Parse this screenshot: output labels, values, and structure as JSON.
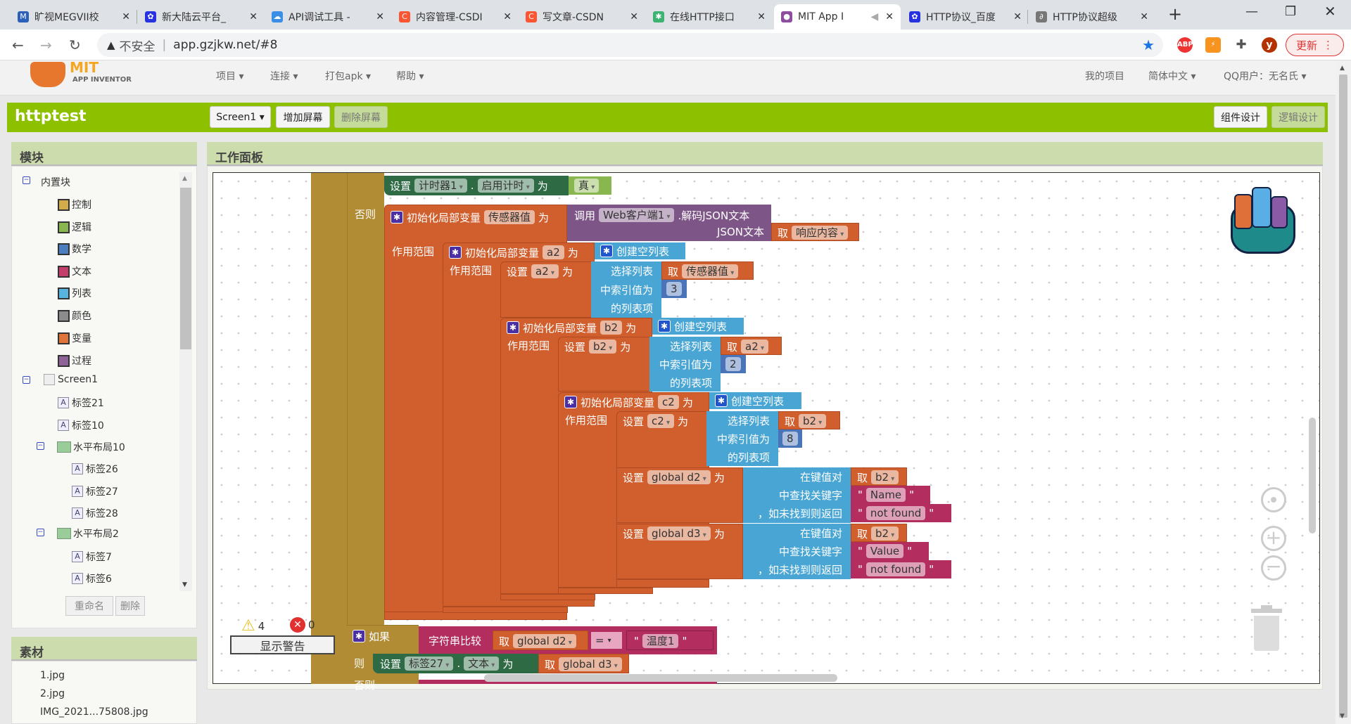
{
  "browser": {
    "tabs": [
      {
        "title": "旷视MEGVII校",
        "icon": "M",
        "color": "#2b5fb8"
      },
      {
        "title": "新大陆云平台_",
        "icon": "paw",
        "color": "#2932e1"
      },
      {
        "title": "API调试工具 -",
        "icon": "cloud",
        "color": "#3a8ee6"
      },
      {
        "title": "内容管理-CSDI",
        "icon": "C",
        "color": "#fc5531"
      },
      {
        "title": "写文章-CSDN",
        "icon": "C",
        "color": "#fc5531"
      },
      {
        "title": "在线HTTP接口",
        "icon": "gear",
        "color": "#3cb371"
      },
      {
        "title": "MIT App I",
        "icon": "mit",
        "color": "#8b4f9e",
        "active": true
      },
      {
        "title": "HTTP协议_百度",
        "icon": "paw",
        "color": "#2932e1"
      },
      {
        "title": "HTTP协议超级",
        "icon": "link",
        "color": "#555"
      }
    ],
    "new_tab": "+",
    "close": "✕",
    "not_secure": "不安全",
    "url": "app.gzjkw.net/#8",
    "update_label": "更新",
    "avatar_letter": "y",
    "abp": "ABP"
  },
  "app": {
    "logo_text": "MIT APP INVENTOR",
    "menu": [
      "项目",
      "连接",
      "打包apk",
      "帮助"
    ],
    "right_menu": [
      "我的项目",
      "简体中文",
      "QQ用户：无名氏"
    ],
    "project": "httptest",
    "screen_select": "Screen1",
    "add_screen": "增加屏幕",
    "remove_screen": "删除屏幕",
    "designer": "组件设计",
    "blocks_editor": "逻辑设计"
  },
  "blocks_panel": {
    "title": "模块",
    "builtin": "内置块",
    "categories": [
      {
        "label": "控制",
        "color": "#d2ab4b"
      },
      {
        "label": "逻辑",
        "color": "#8ab650"
      },
      {
        "label": "数学",
        "color": "#4a7ebf"
      },
      {
        "label": "文本",
        "color": "#c43d6b"
      },
      {
        "label": "列表",
        "color": "#57b4df"
      },
      {
        "label": "颜色",
        "color": "#8c8c8c"
      },
      {
        "label": "变量",
        "color": "#e07438"
      },
      {
        "label": "过程",
        "color": "#8e6397"
      }
    ],
    "screen": "Screen1",
    "components": [
      {
        "label": "标签21",
        "type": "label",
        "level": 1
      },
      {
        "label": "标签10",
        "type": "label",
        "level": 1
      },
      {
        "label": "水平布局10",
        "type": "layout",
        "level": 1
      },
      {
        "label": "标签26",
        "type": "label",
        "level": 2
      },
      {
        "label": "标签27",
        "type": "label",
        "level": 2
      },
      {
        "label": "标签28",
        "type": "label",
        "level": 2
      },
      {
        "label": "水平布局2",
        "type": "layout",
        "level": 1
      },
      {
        "label": "标签7",
        "type": "label",
        "level": 2
      },
      {
        "label": "标签6",
        "type": "label",
        "level": 2
      }
    ],
    "rename": "重命名",
    "delete": "删除"
  },
  "media": {
    "title": "素材",
    "files": [
      "1.jpg",
      "2.jpg",
      "IMG_2021...75808.jpg"
    ]
  },
  "workspace": {
    "title": "工作面板",
    "warnings": "4",
    "errors": "0",
    "show_warnings": "显示警告",
    "blocks": {
      "set": "设置",
      "to": "为",
      "dot": ".",
      "get": "取",
      "scope": "作用范围",
      "else": "否则",
      "if": "如果",
      "then": "则",
      "init_local": "初始化局部变量",
      "timer": "计时器1",
      "timer_enabled": "启用计时",
      "true": "真",
      "sensor_var": "传感器值",
      "call": "调用",
      "web": "Web客户端1",
      "decode": ".解码JSON文本",
      "json_text": "JSON文本",
      "response": "响应内容",
      "create_list": "创建空列表",
      "select_list": "选择列表",
      "index": "中索引值为",
      "list_item": "的列表项",
      "a2": "a2",
      "b2": "b2",
      "c2": "c2",
      "n3": "3",
      "n2": "2",
      "n8": "8",
      "d2": "global d2",
      "d3": "global d3",
      "in_pairs": "在键值对",
      "find_key": "中查找关键字",
      "not_found_return": "，如未找到则返回",
      "name": "Name",
      "value": "Value",
      "not_found": "not found",
      "compare": "字符串比较",
      "eq": "=",
      "temp": "温度1",
      "label27": "标签27",
      "text_prop": "文本",
      "q": "\""
    }
  }
}
